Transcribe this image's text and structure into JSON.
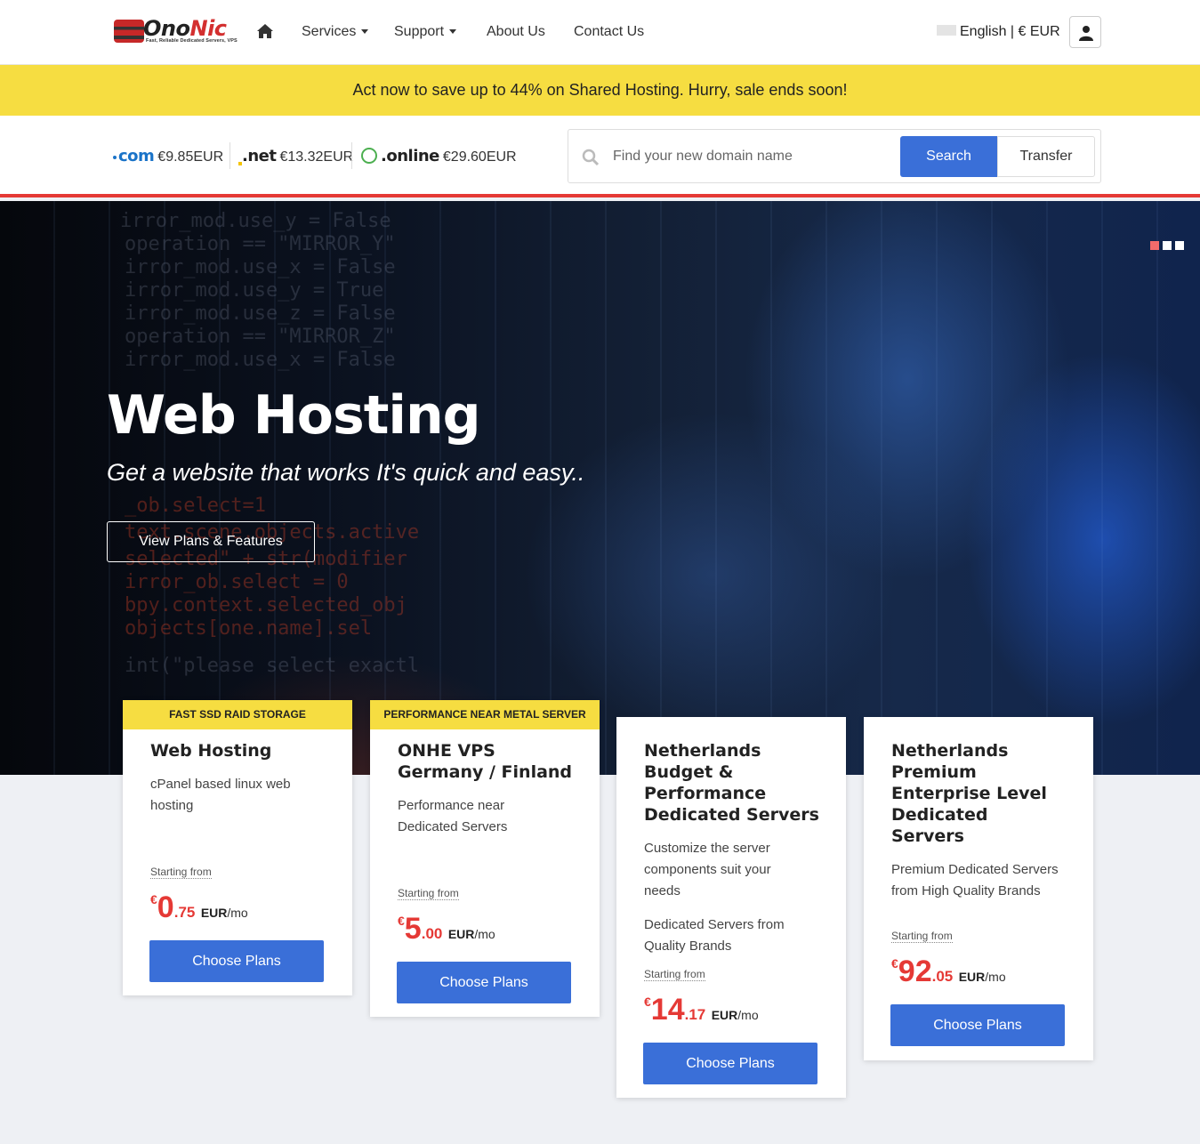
{
  "brand": {
    "name_part1": "Ono",
    "name_part2": "Nic",
    "tagline": "Fast, Reliable Dedicated Servers, VPS"
  },
  "nav": {
    "home_icon": "home-icon",
    "services": "Services",
    "support": "Support",
    "about": "About Us",
    "contact": "Contact Us",
    "language": "English | € EUR"
  },
  "promo": {
    "text": "Act now to save up to 44% on Shared Hosting. Hurry, sale ends soon!"
  },
  "domains": {
    "tlds": [
      {
        "name": "com",
        "price": "€9.85EUR"
      },
      {
        "name": ".net",
        "price": "€13.32EUR"
      },
      {
        "name": ".online",
        "price": "€29.60EUR"
      }
    ],
    "search_placeholder": "Find your new domain name",
    "search_button": "Search",
    "transfer_button": "Transfer"
  },
  "hero": {
    "title": "Web Hosting",
    "subtitle": "Get a website that works It's quick and easy..",
    "button": "View Plans & Features",
    "slides": 3,
    "active_slide": 1
  },
  "cards": [
    {
      "badge": "FAST SSD RAID STORAGE",
      "title": "Web Hosting",
      "desc": "cPanel based linux web hosting",
      "desc2": "",
      "starting": "Starting from",
      "currency": "€",
      "price_main": "0",
      "price_cents": ".75",
      "unit": "EUR",
      "period": "/mo",
      "button": "Choose Plans"
    },
    {
      "badge": "PERFORMANCE NEAR METAL SERVER",
      "title": "ONHE VPS Germany / Finland",
      "desc": "Performance near Dedicated Servers",
      "desc2": "",
      "starting": "Starting from",
      "currency": "€",
      "price_main": "5",
      "price_cents": ".00",
      "unit": "EUR",
      "period": "/mo",
      "button": "Choose Plans"
    },
    {
      "badge": "",
      "title": "Netherlands Budget & Performance Dedicated Servers",
      "desc": "Customize the server components suit your needs",
      "desc2": "Dedicated Servers from Quality Brands",
      "starting": "Starting from",
      "currency": "€",
      "price_main": "14",
      "price_cents": ".17",
      "unit": "EUR",
      "period": "/mo",
      "button": "Choose Plans"
    },
    {
      "badge": "",
      "title": "Netherlands Premium Enterprise Level Dedicated Servers",
      "desc": "Premium Dedicated Servers from High Quality Brands",
      "desc2": "",
      "starting": "Starting from",
      "currency": "€",
      "price_main": "92",
      "price_cents": ".05",
      "unit": "EUR",
      "period": "/mo",
      "button": "Choose Plans"
    }
  ],
  "colors": {
    "accent_blue": "#3a6fd8",
    "promo_yellow": "#f6dd41",
    "price_red": "#e53935"
  }
}
